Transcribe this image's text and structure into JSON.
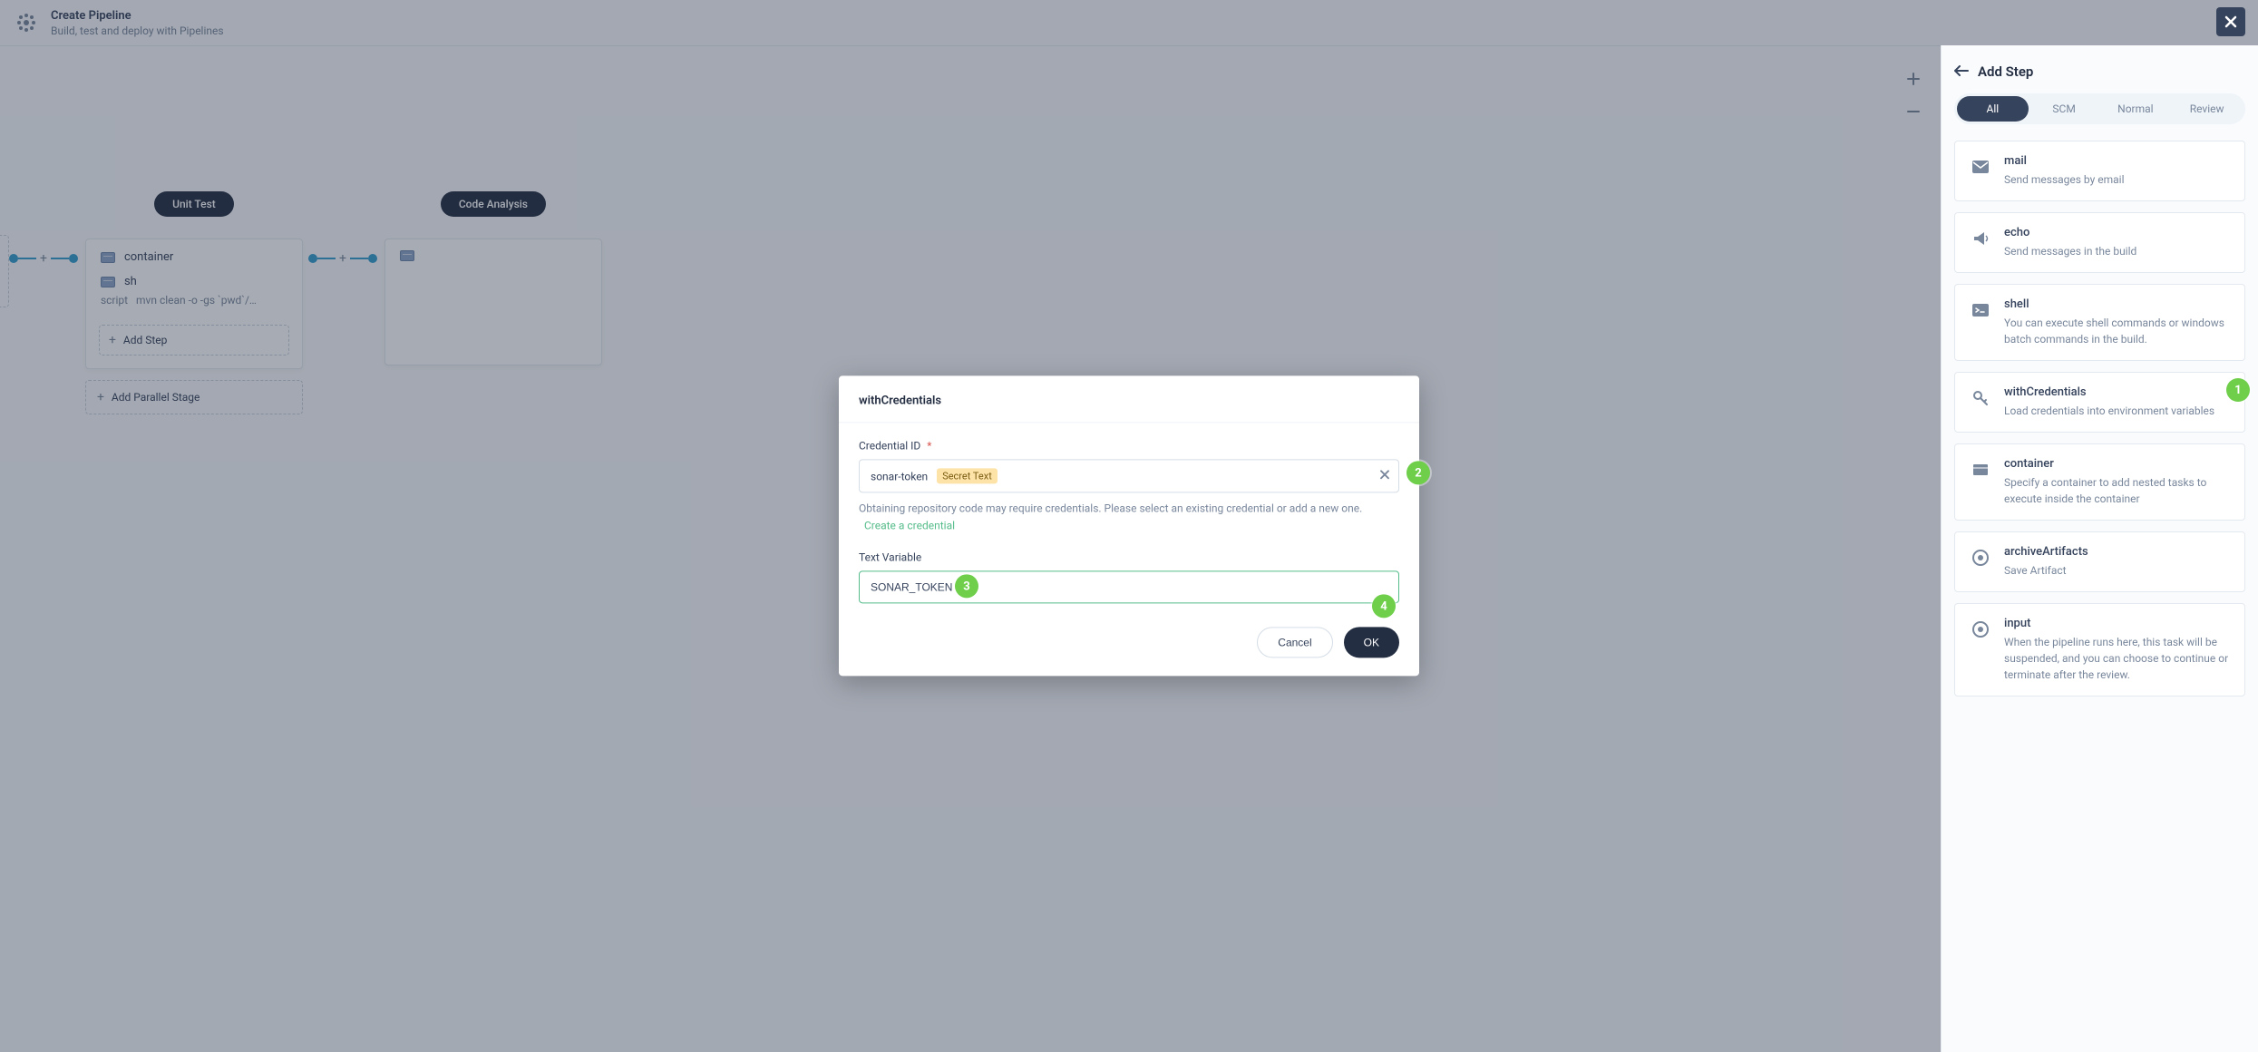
{
  "header": {
    "title": "Create Pipeline",
    "subtitle": "Build, test and deploy with Pipelines"
  },
  "canvas": {
    "stages": [
      {
        "chip": "Unit Test",
        "container_row": "container",
        "sh_row": "sh",
        "script_label": "script",
        "script_value": "mvn clean -o -gs `pwd`/…",
        "add_step": "Add Step",
        "add_parallel": "Add Parallel Stage"
      },
      {
        "chip": "Code Analysis"
      }
    ]
  },
  "modal": {
    "title": "withCredentials",
    "field_credential_label": "Credential ID",
    "credential_value": "sonar-token",
    "credential_type_chip": "Secret Text",
    "help_text": "Obtaining repository code may require credentials. Please select an existing credential or add a new one.",
    "create_credential": "Create a credential",
    "field_text_variable_label": "Text Variable",
    "text_variable_value": "SONAR_TOKEN",
    "cancel": "Cancel",
    "ok": "OK"
  },
  "side": {
    "title": "Add Step",
    "tabs": [
      "All",
      "SCM",
      "Normal",
      "Review"
    ],
    "active_tab": 0,
    "steps": [
      {
        "name": "mail",
        "desc": "Send messages by email",
        "icon": "mail"
      },
      {
        "name": "echo",
        "desc": "Send messages in the build",
        "icon": "megaphone"
      },
      {
        "name": "shell",
        "desc": "You can execute shell commands or windows batch commands in the build.",
        "icon": "terminal"
      },
      {
        "name": "withCredentials",
        "desc": "Load credentials into environment variables",
        "icon": "key"
      },
      {
        "name": "container",
        "desc": "Specify a container to add nested tasks to execute inside the container",
        "icon": "box"
      },
      {
        "name": "archiveArtifacts",
        "desc": "Save Artifact",
        "icon": "target"
      },
      {
        "name": "input",
        "desc": "When the pipeline runs here, this task will be suspended, and you can choose to continue or terminate after the review.",
        "icon": "target"
      }
    ]
  },
  "badges": {
    "1": true,
    "2": true,
    "3": true,
    "4": true
  }
}
